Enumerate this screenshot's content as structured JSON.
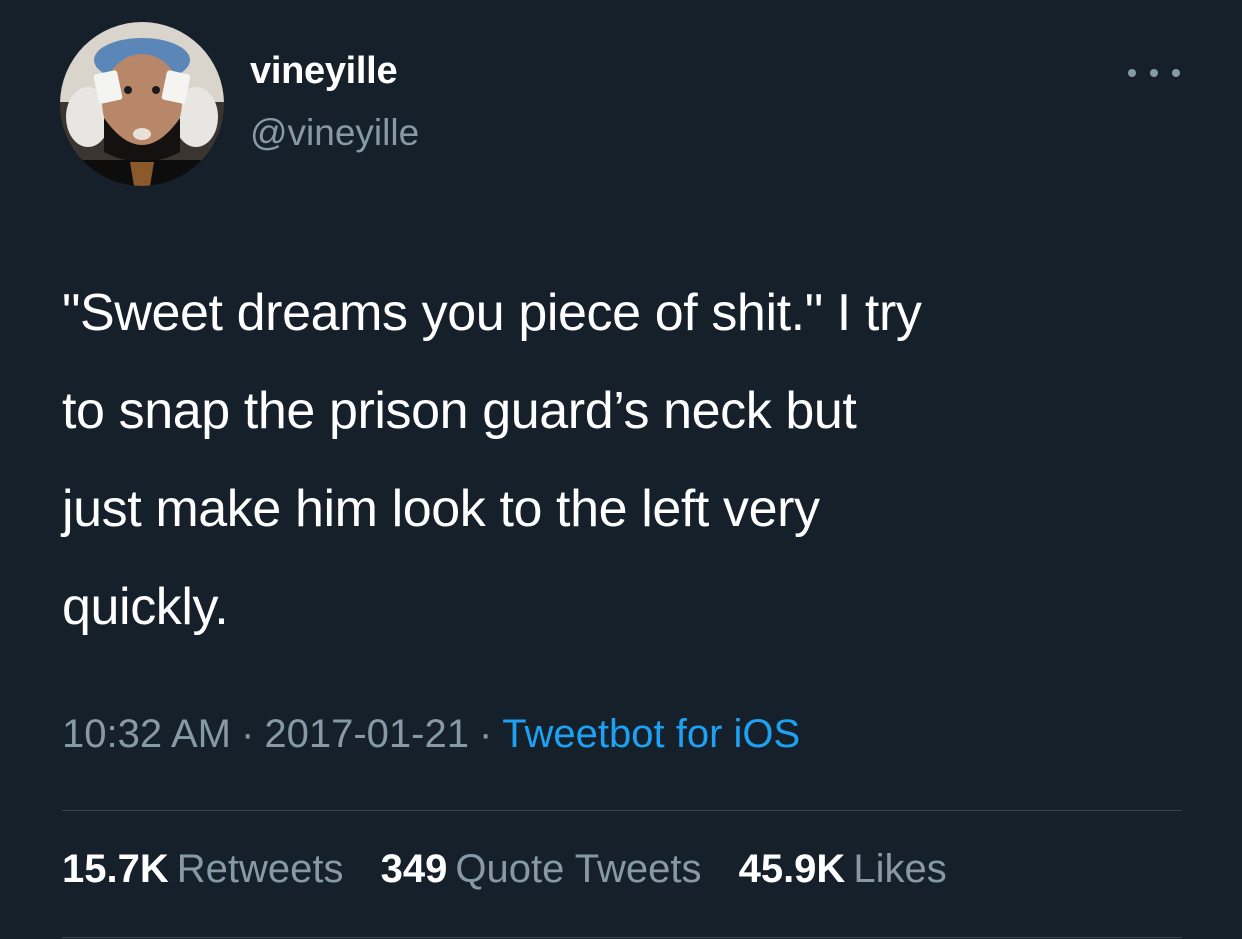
{
  "author": {
    "display_name": "vineyille",
    "handle": "@vineyille"
  },
  "tweet": {
    "lines": [
      "\"Sweet dreams you piece of shit.\" I try",
      "to snap the prison guard’s neck but",
      "just make him look to the left very",
      "quickly."
    ],
    "time": "10:32 AM",
    "date": "2017-01-21",
    "separator": "·",
    "source": "Tweetbot for iOS"
  },
  "stats": {
    "retweets_count": "15.7K",
    "retweets_label": "Retweets",
    "quotes_count": "349",
    "quotes_label": "Quote Tweets",
    "likes_count": "45.9K",
    "likes_label": "Likes"
  },
  "icons": {
    "more": "more-horizontal-icon",
    "avatar": "profile-photo"
  },
  "colors": {
    "background": "#15202b",
    "primary_text": "#ffffff",
    "secondary_text": "#8899a6",
    "link": "#1da1f2",
    "divider": "#38444d"
  }
}
